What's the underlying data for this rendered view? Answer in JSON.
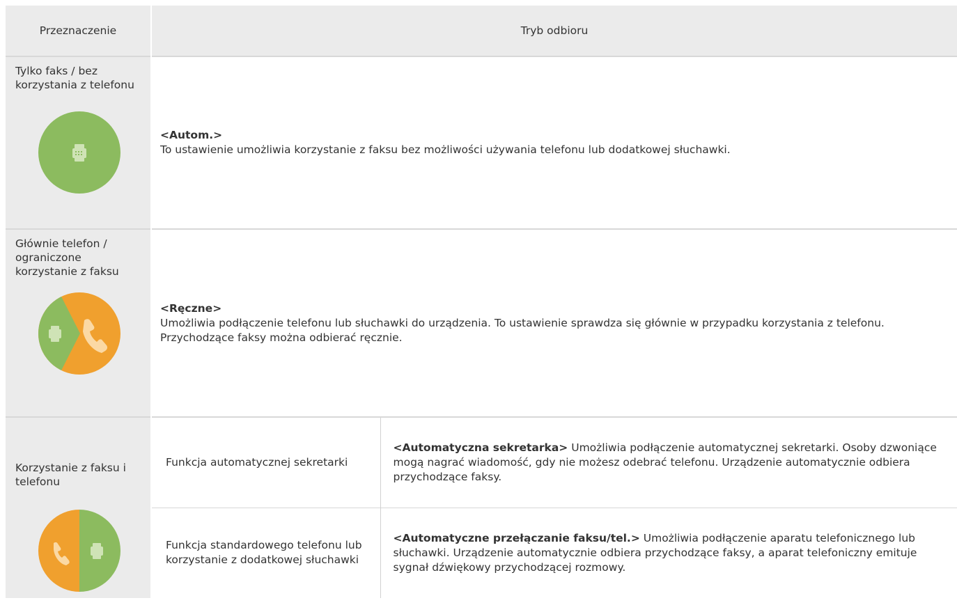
{
  "header": {
    "purpose": "Przeznaczenie",
    "mode": "Tryb odbioru"
  },
  "rows": [
    {
      "purpose": "Tylko faks / bez korzystania z telefonu",
      "icon": "fax-only-icon",
      "mode_title": "<Autom.>",
      "mode_text": "To ustawienie umożliwia korzystanie z faksu bez możliwości używania telefonu lub dodatkowej słuchawki."
    },
    {
      "purpose": "Głównie telefon / ograniczone korzystanie z faksu",
      "icon": "phone-mostly-icon",
      "mode_title": "<Ręczne>",
      "mode_text": "Umożliwia podłączenie telefonu lub słuchawki do urządzenia. To ustawienie sprawdza się głównie w przypadku korzystania z telefonu. Przychodzące faksy można odbierać ręcznie."
    },
    {
      "purpose": "Korzystanie z faksu i telefonu",
      "icon": "fax-and-phone-icon",
      "sub": [
        {
          "function": "Funkcja automatycznej sekretarki",
          "mode_title": "<Automatyczna sekretarka>",
          "mode_text": "Umożliwia podłączenie automatycznej sekretarki. Osoby dzwoniące mogą nagrać wiadomość, gdy nie możesz odebrać telefonu. Urządzenie automatycznie odbiera przychodzące faksy."
        },
        {
          "function": "Funkcja standardowego telefonu lub korzystanie z dodatkowej słuchawki",
          "mode_title": "<Automatyczne przełączanie faksu/tel.>",
          "mode_text": "Umożliwia podłączenie aparatu telefonicznego lub słuchawki. Urządzenie automatycznie odbiera przychodzące faksy, a aparat telefoniczny emituje sygnał dźwiękowy przychodzącej rozmowy."
        }
      ]
    }
  ],
  "colors": {
    "green": "#8cbb5f",
    "orange": "#f0a02e",
    "header_bg": "#ebebeb"
  }
}
